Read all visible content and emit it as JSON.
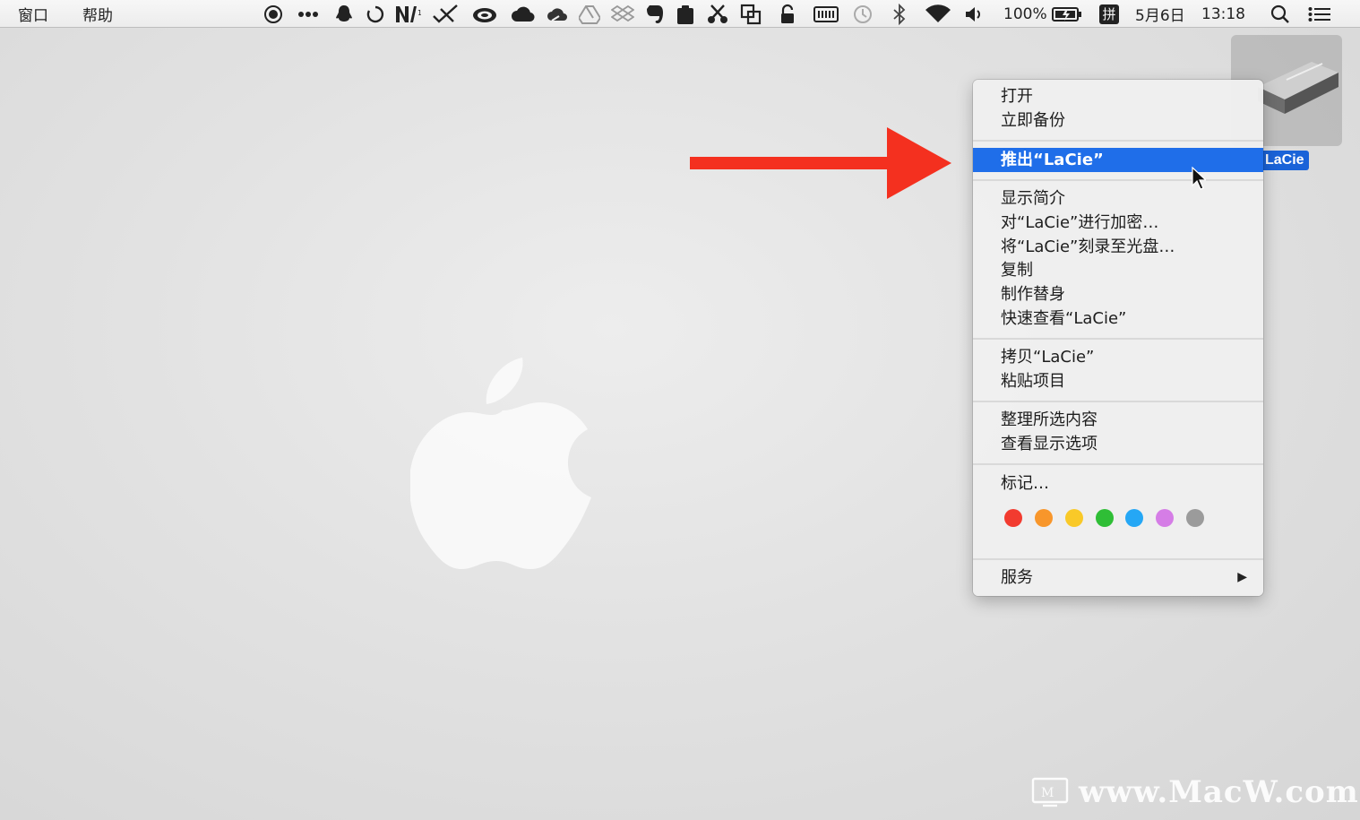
{
  "menubar": {
    "menus": [
      "窗口",
      "帮助"
    ],
    "status_icons": [
      "record-icon",
      "more-icon",
      "qq-penguin-icon",
      "sync-circle-icon",
      "text-tool-icon",
      "crossed-tools-icon",
      "creative-cloud-icon",
      "cloud-icon",
      "cloud-outline-icon",
      "google-drive-icon",
      "dropbox-icon",
      "evernote-icon",
      "clipboard-icon",
      "scissors-icon",
      "copy-window-icon",
      "lock-icon",
      "keyboard-icon",
      "time-machine-icon",
      "bluetooth-icon",
      "wifi-icon",
      "volume-icon"
    ],
    "battery_percent": "100%",
    "input_method": "拼",
    "date": "5月6日",
    "time": "13:18"
  },
  "desktop": {
    "drive_label": "LaCie"
  },
  "context_menu": {
    "group1": [
      "打开",
      "立即备份"
    ],
    "highlighted": "推出“LaCie”",
    "group2": [
      "显示简介",
      "对“LaCie”进行加密…",
      "将“LaCie”刻录至光盘…",
      "复制",
      "制作替身",
      "快速查看“LaCie”"
    ],
    "group3": [
      "拷贝“LaCie”",
      "粘贴项目"
    ],
    "group4": [
      "整理所选内容",
      "查看显示选项"
    ],
    "tags_label": "标记…",
    "tag_colors": [
      "#f23b2f",
      "#f8962b",
      "#f9c928",
      "#2fbe36",
      "#25a7f5",
      "#d57de6",
      "#9b9b9b"
    ],
    "services_label": "服务"
  },
  "watermark": {
    "text": "www.MacW.com"
  },
  "colors": {
    "highlight": "#1f6ee9",
    "arrow": "#f4301f"
  }
}
